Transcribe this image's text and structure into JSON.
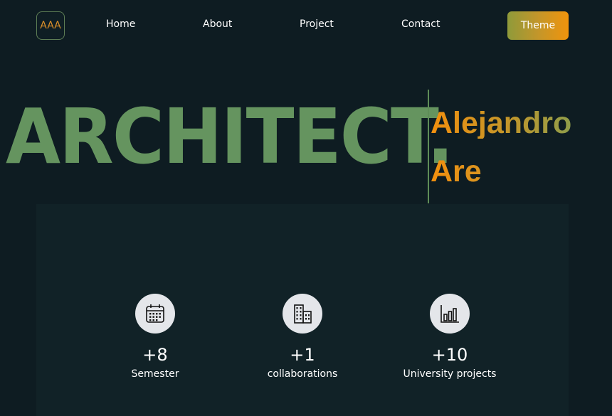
{
  "nav": {
    "logo_text": "AAA",
    "links": [
      {
        "label": "Home"
      },
      {
        "label": "About"
      },
      {
        "label": "Project"
      },
      {
        "label": "Contact"
      }
    ],
    "theme_label": "Theme"
  },
  "hero": {
    "title": "ARCHITECT.",
    "name_first": "Alejandro",
    "name_last": "Are"
  },
  "stats": [
    {
      "icon": "calendar-icon",
      "value": "+8",
      "label": "Semester"
    },
    {
      "icon": "buildings-icon",
      "value": "+1",
      "label": "collaborations"
    },
    {
      "icon": "bar-chart-icon",
      "value": "+10",
      "label": "University projects"
    }
  ],
  "colors": {
    "background": "#0e1c22",
    "panel": "#112227",
    "accent_green": "#65945f",
    "accent_orange": "#f28f0e"
  }
}
